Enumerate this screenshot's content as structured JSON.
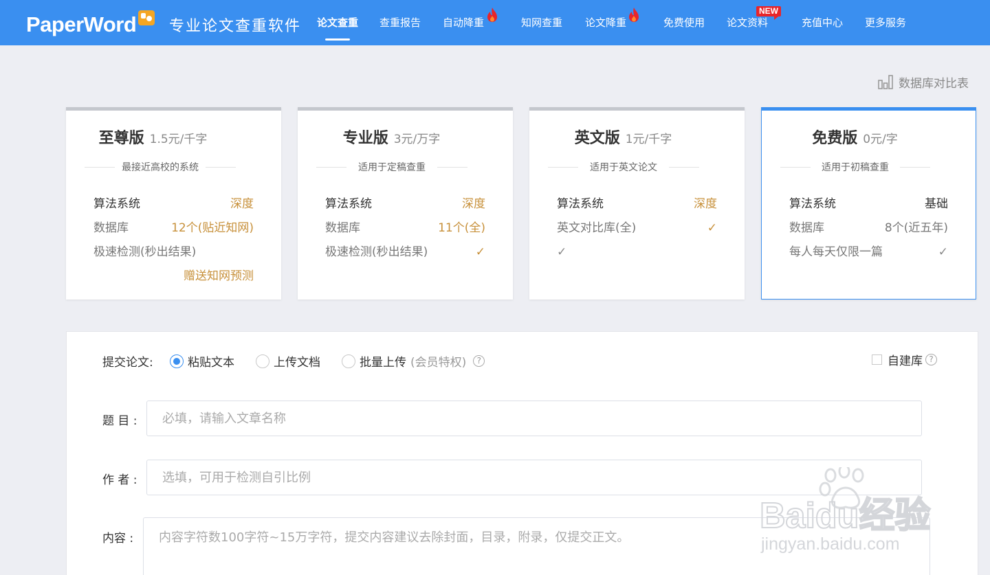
{
  "header": {
    "logo_text": "PaperWord",
    "slogan": "专业论文查重软件",
    "nav": [
      {
        "label": "论文查重",
        "active": true
      },
      {
        "label": "查重报告"
      },
      {
        "label": "自动降重",
        "hot": true
      },
      {
        "label": "知网查重"
      },
      {
        "label": "论文降重",
        "hot": true
      },
      {
        "label": "免费使用"
      },
      {
        "label": "论文资料",
        "badge": "NEW"
      },
      {
        "label": "充值中心"
      },
      {
        "label": "更多服务"
      }
    ]
  },
  "db_compare_label": "数据库对比表",
  "plans": [
    {
      "name": "至尊版",
      "price": "1.5元/千字",
      "subtitle": "最接近高校的系统",
      "rows": [
        {
          "k": "算法系统",
          "v": "深度"
        },
        {
          "k": "数据库",
          "v": "12个(贴近知网)"
        },
        {
          "k": "极速检测(秒出结果)",
          "v": ""
        }
      ],
      "extra": "赠送知网预测"
    },
    {
      "name": "专业版",
      "price": "3元/万字",
      "subtitle": "适用于定稿查重",
      "rows": [
        {
          "k": "算法系统",
          "v": "深度"
        },
        {
          "k": "数据库",
          "v": "11个(全)"
        },
        {
          "k": "极速检测(秒出结果)",
          "v": "✓"
        }
      ]
    },
    {
      "name": "英文版",
      "price": "1元/千字",
      "subtitle": "适用于英文论文",
      "rows": [
        {
          "k": "算法系统",
          "v": "深度"
        },
        {
          "k": "英文对比库(全)",
          "v": "✓"
        },
        {
          "k": "✓",
          "v": ""
        }
      ]
    },
    {
      "name": "免费版",
      "price": "0元/字",
      "subtitle": "适用于初稿查重",
      "selected": true,
      "rows": [
        {
          "k": "算法系统",
          "v": "基础"
        },
        {
          "k": "数据库",
          "v": "8个(近五年)"
        },
        {
          "k": "每人每天仅限一篇",
          "v": "✓"
        }
      ]
    }
  ],
  "form": {
    "submit_label": "提交论文:",
    "options": [
      {
        "label": "粘贴文本",
        "checked": true
      },
      {
        "label": "上传文档"
      },
      {
        "label": "批量上传",
        "note": "(会员特权)"
      }
    ],
    "help_icon": "?",
    "self_db_label": "自建库",
    "title_label": "题 目 :",
    "title_placeholder": "必填，请输入文章名称",
    "author_label": "作 者 :",
    "author_placeholder": "选填，可用于检测自引比例",
    "content_label": "内容 :",
    "content_placeholder": "内容字符数100字符~15万字符，提交内容建议去除封面，目录，附录，仅提交正文。"
  },
  "watermark": {
    "brand": "Baidu经验",
    "url": "jingyan.baidu.com"
  },
  "colors": {
    "primary": "#3a8ff0",
    "accent": "#c7903a",
    "hot": "#e8252a",
    "logo_badge": "#f5a623"
  }
}
